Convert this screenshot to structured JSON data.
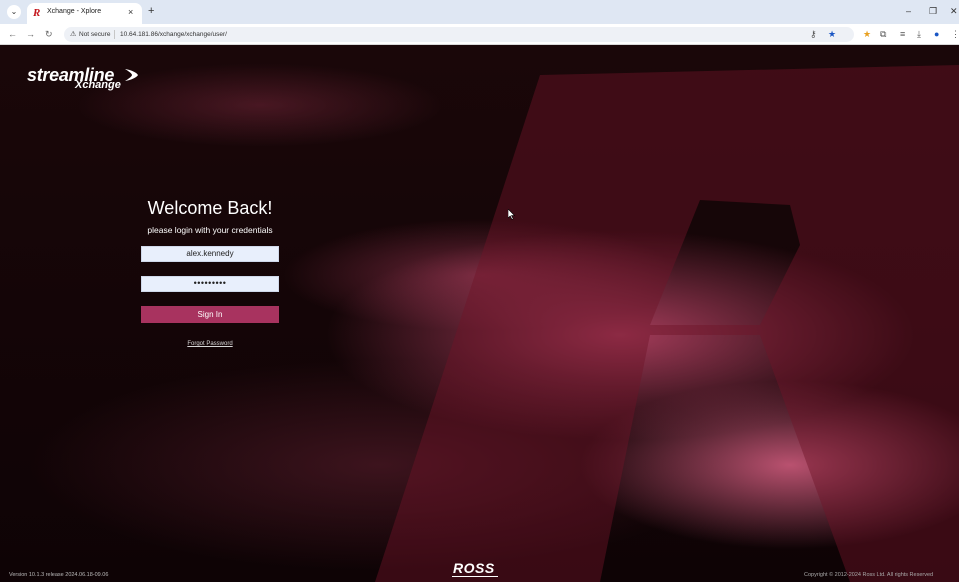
{
  "browser": {
    "tab_title": "Xchange - Xplore",
    "tab_favicon": "R",
    "new_tab": "+",
    "tab_close": "×",
    "tab_menu": "⌄",
    "not_secure": "Not secure",
    "url": "10.64.181.86/xchange/xchange/user/",
    "window_controls": {
      "minimize": "–",
      "maximize": "❐",
      "close": "✕"
    }
  },
  "logo": {
    "main": "streamline",
    "sub": "Xchange"
  },
  "login": {
    "title": "Welcome Back!",
    "subtitle": "please login with your credentials",
    "username_value": "alex.kennedy",
    "password_mask": "•••••••••",
    "signin_label": "Sign In",
    "forgot_label": "Forgot Password"
  },
  "footer": {
    "version": "Version 10.1.3 release 2024.06.18-09.06",
    "brand": "ROSS",
    "copyright": "Copyright © 2012-2024 Ross Ltd. All rights Reserved"
  },
  "colors": {
    "accent": "#a8335f",
    "tab_bar": "#dfe7f3"
  }
}
